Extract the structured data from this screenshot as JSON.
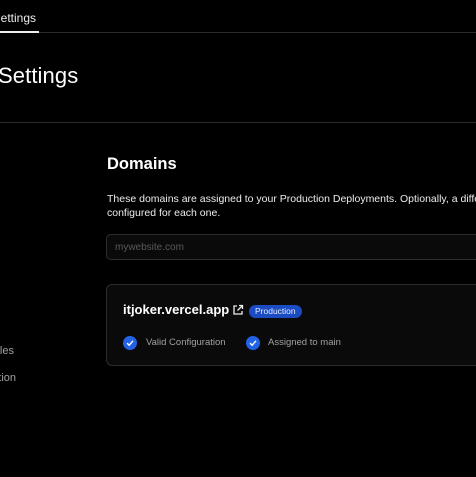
{
  "topbar": {
    "active_tab": "Settings"
  },
  "page": {
    "title": "Settings"
  },
  "sidebar": {
    "items": [
      {
        "label": "Environment Variables"
      },
      {
        "label": "Integration"
      }
    ]
  },
  "domains": {
    "title": "Domains",
    "description_line1": "These domains are assigned to your Production Deployments. Optionally, a different Git branch",
    "description_line2": "configured for each one.",
    "input_placeholder": "mywebsite.com",
    "entries": [
      {
        "name": "itjoker.vercel.app",
        "badge": "Production",
        "statuses": [
          {
            "label": "Valid Configuration",
            "icon": "check-circle-icon"
          },
          {
            "label": "Assigned to main",
            "icon": "check-circle-icon"
          }
        ]
      }
    ]
  },
  "colors": {
    "background": "#000000",
    "accent": "#2263e6",
    "badge": "#1b4cc4"
  }
}
